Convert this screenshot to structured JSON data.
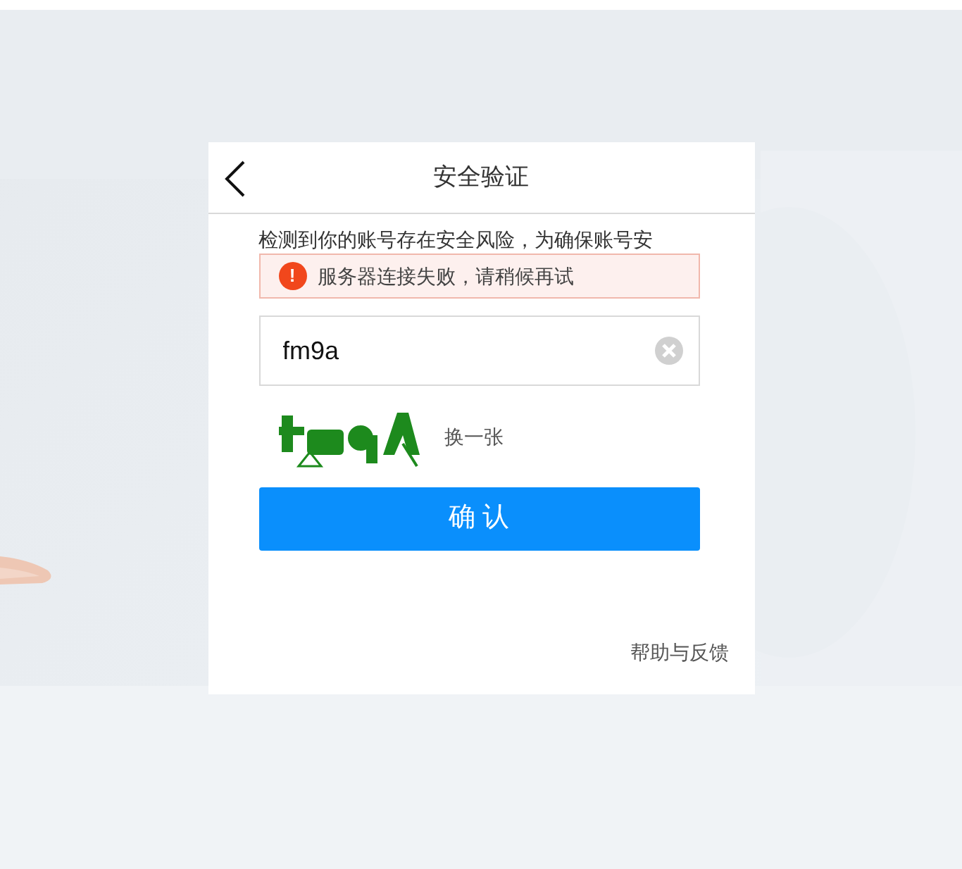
{
  "header": {
    "title": "安全验证"
  },
  "notice": "检测到你的账号存在安全风险，为确保账号安",
  "toast": {
    "icon": "!",
    "message": "服务器连接失败，请稍候再试"
  },
  "captcha_field": {
    "value": "fm9a"
  },
  "captcha": {
    "kind": "picture",
    "refresh": "换一张"
  },
  "confirm_button": "确 认",
  "help_link": "帮助与反馈"
}
